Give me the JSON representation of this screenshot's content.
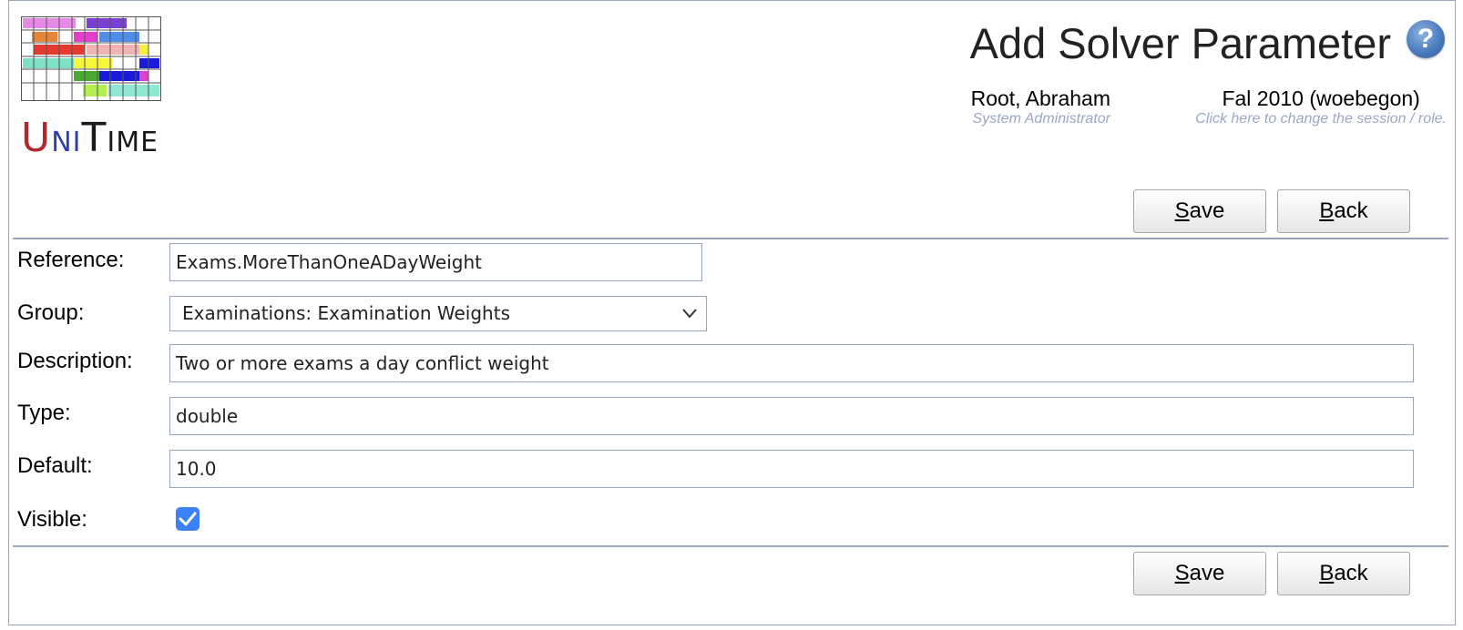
{
  "logo": {
    "u": "U",
    "ni": "NI",
    "t": "T",
    "ime": "IME"
  },
  "header": {
    "title": "Add Solver Parameter",
    "help_icon": "question-mark-icon",
    "user": {
      "name": "Root, Abraham",
      "role": "System Administrator"
    },
    "session": {
      "name": "Fal 2010 (woebegon)",
      "hint": "Click here to change the session / role."
    }
  },
  "buttons": {
    "save_access": "S",
    "save_rest": "ave",
    "back_access": "B",
    "back_rest": "ack"
  },
  "form": {
    "reference": {
      "label": "Reference:",
      "value": "Exams.MoreThanOneADayWeight"
    },
    "group": {
      "label": "Group:",
      "value": "Examinations: Examination Weights"
    },
    "description": {
      "label": "Description:",
      "value": "Two or more exams a day conflict weight"
    },
    "type": {
      "label": "Type:",
      "value": "double"
    },
    "default": {
      "label": "Default:",
      "value": "10.0"
    },
    "visible": {
      "label": "Visible:",
      "checked": true
    }
  },
  "colors": {
    "border": "#9aa6c0",
    "accent": "#3b82f6"
  }
}
